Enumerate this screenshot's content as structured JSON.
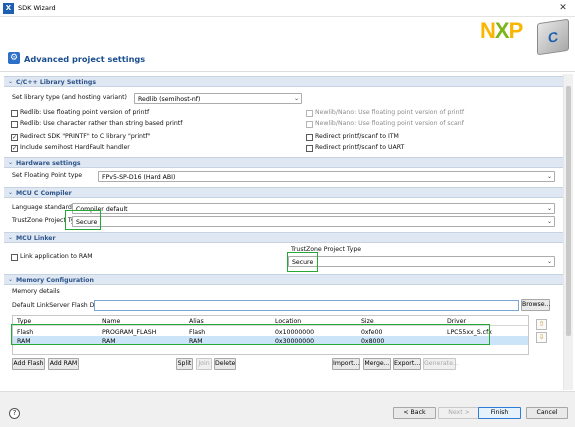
{
  "window": {
    "title": "SDK Wizard",
    "close_glyph": "✕"
  },
  "header": {
    "title": "Advanced project settings",
    "logo_text_n": "N",
    "logo_text_x": "X",
    "logo_text_p": "P",
    "logo_badge": "C"
  },
  "sections": {
    "lib": "C/C++ Library Settings",
    "hw": "Hardware settings",
    "compiler": "MCU C Compiler",
    "linker": "MCU Linker",
    "memory": "Memory Configuration"
  },
  "lib": {
    "type_label": "Set library type (and hosting variant)",
    "type_value": "Redlib (semihost-nf)",
    "chk1": "Redlib: Use floating point version of printf",
    "chk2": "Redlib: Use character rather than string based printf",
    "chk3": "Newlib/Nano: Use floating point version of printf",
    "chk4": "Newlib/Nano: Use floating point version of scanf",
    "chk5": "Redirect SDK \"PRINTF\" to C library \"printf\"",
    "chk6": "Redirect printf/scanf to ITM",
    "chk7": "Include semihost HardFault handler",
    "chk8": "Redirect printf/scanf to UART"
  },
  "hw": {
    "fp_label": "Set Floating Point type",
    "fp_value": "FPv5-SP-D16 (Hard ABI)"
  },
  "compiler": {
    "std_label": "Language standard",
    "std_value": "Compiler default",
    "tz_label": "TrustZone Project Type",
    "tz_value": "Secure"
  },
  "linker": {
    "link_ram": "Link application to RAM",
    "tz_label": "TrustZone Project Type",
    "tz_value": "Secure"
  },
  "memory": {
    "details": "Memory details",
    "driver_label": "Default LinkServer Flash Driver",
    "browse": "Browse...",
    "columns": [
      "Type",
      "Name",
      "Alias",
      "Location",
      "Size",
      "Driver"
    ],
    "rows": [
      [
        "Flash",
        "PROGRAM_FLASH",
        "Flash",
        "0x10000000",
        "0xfe00",
        "LPC55xx_S.cfx"
      ],
      [
        "RAM",
        "RAM",
        "RAM",
        "0x30000000",
        "0x8000",
        ""
      ]
    ],
    "buttons": {
      "add_flash": "Add Flash",
      "add_ram": "Add RAM",
      "split": "Split",
      "join": "Join",
      "delete": "Delete",
      "import": "Import...",
      "merge": "Merge...",
      "export": "Export...",
      "generate": "Generate..."
    }
  },
  "footer": {
    "help": "?",
    "back": "< Back",
    "next": "Next >",
    "finish": "Finish",
    "cancel": "Cancel"
  },
  "colors": {
    "accent": "#1a4f8f",
    "highlight": "#27a836",
    "section_bg": "#dfe7f2"
  }
}
